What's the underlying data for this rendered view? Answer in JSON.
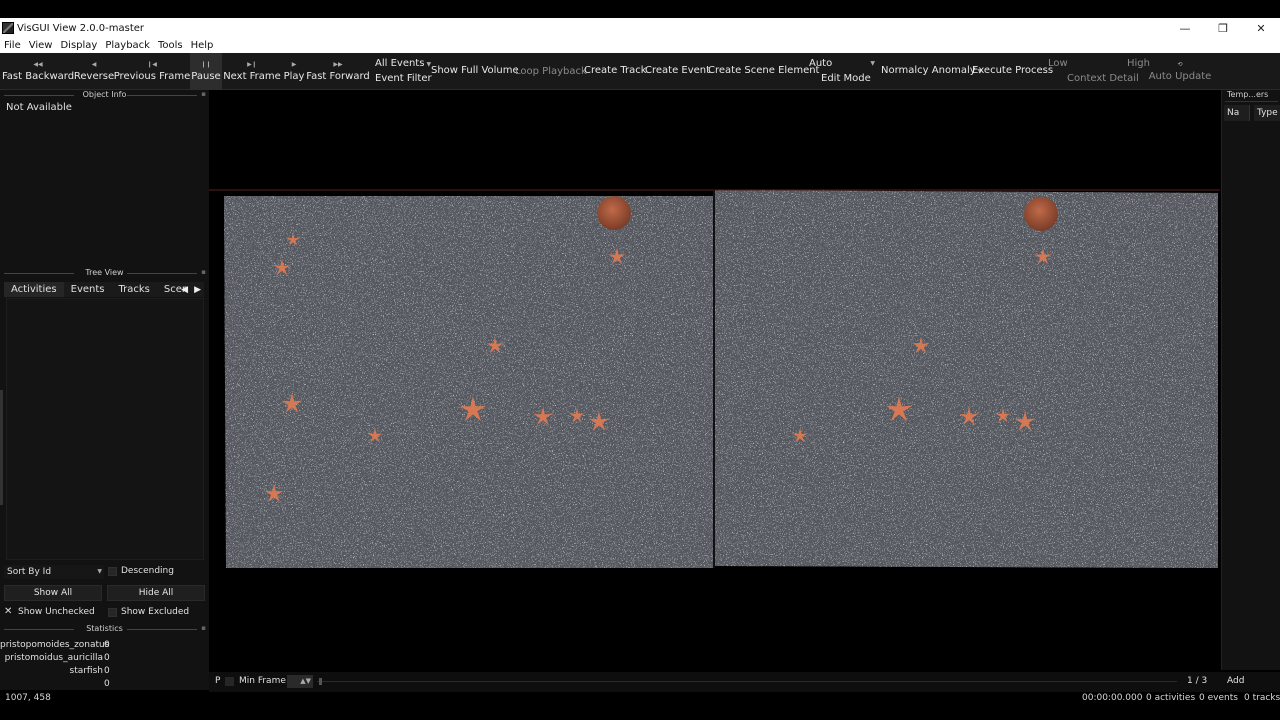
{
  "window": {
    "title": "VisGUI View 2.0.0-master",
    "minimize": "—",
    "restore": "❐",
    "close": "✕"
  },
  "menu": [
    "File",
    "View",
    "Display",
    "Playback",
    "Tools",
    "Help"
  ],
  "toolbar": {
    "fast_backward": "Fast Backward",
    "reverse": "Reverse",
    "previous_frame": "Previous Frame",
    "pause": "Pause",
    "next_frame": "Next Frame",
    "play": "Play",
    "fast_forward": "Fast Forward",
    "all_events": "All Events",
    "event_filter": "Event Filter",
    "show_full_volume": "Show Full Volume",
    "loop_playback": "Loop Playback",
    "create_track": "Create Track",
    "create_event": "Create Event",
    "create_scene_element": "Create Scene Element",
    "edit_mode_value": "Auto",
    "edit_mode": "Edit Mode",
    "normalcy_anomaly": "Normalcy Anomaly",
    "execute_process": "Execute Process",
    "low": "Low",
    "high": "High",
    "context_detail": "Context Detail",
    "auto_update": "Auto Update"
  },
  "left_panel": {
    "object_info_title": "Object Info",
    "object_info_text": "Not Available",
    "tree_view_title": "Tree View",
    "tabs": [
      "Activities",
      "Events",
      "Tracks",
      "Scen"
    ],
    "sort_by": "Sort By Id",
    "descending": "Descending",
    "show_all": "Show All",
    "hide_all": "Hide All",
    "show_unchecked": "Show Unchecked",
    "show_excluded": "Show Excluded",
    "statistics_title": "Statistics",
    "stats": [
      {
        "name": "pristopomoides_zonatus",
        "value": "0"
      },
      {
        "name": "pristomoidus_auricilla",
        "value": "0"
      },
      {
        "name": "starfish",
        "value": "0"
      },
      {
        "name": "",
        "value": "0"
      }
    ]
  },
  "right_panel": {
    "title": "Temp...ers",
    "col_name": "Na",
    "col_type": "Type"
  },
  "frame_bar": {
    "p_label": "P",
    "min_frame": "Min Frame",
    "frame_counter": "1 / 3",
    "add": "Add"
  },
  "status_bar": {
    "coords": "1007, 458",
    "time": "00:00:00.000",
    "activities": "0 activities",
    "events": "0 events",
    "tracks": "0 tracks"
  },
  "colors": {
    "seafloor": "#55595f",
    "starfish": "#e07a52",
    "shell": "#a85a3e"
  }
}
